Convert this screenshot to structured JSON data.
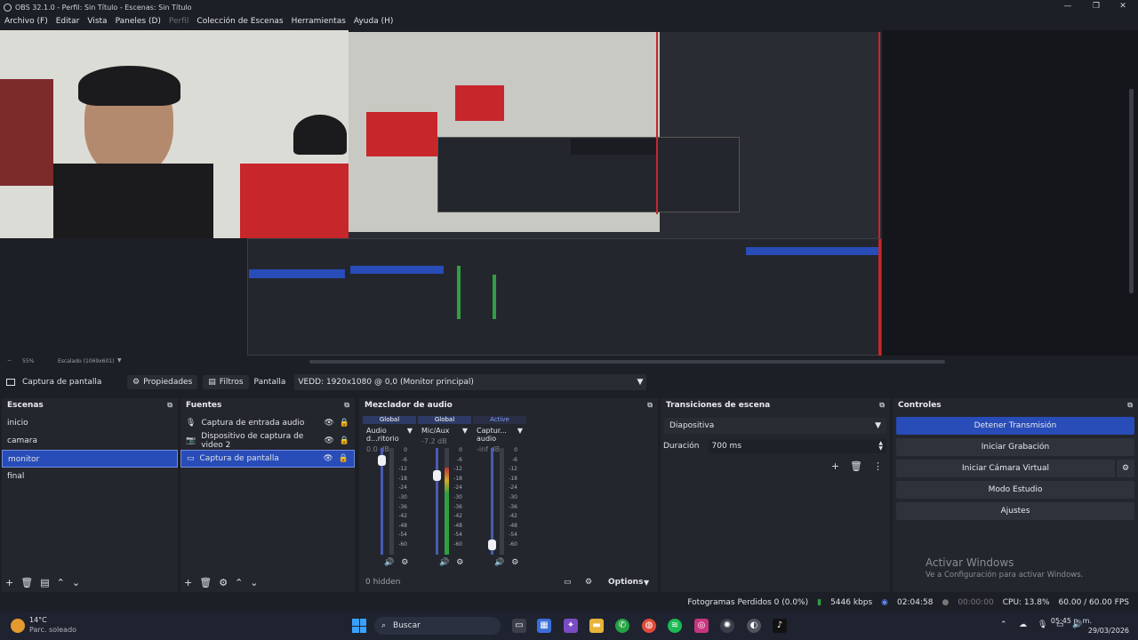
{
  "window": {
    "title": "OBS 32.1.0 - Perfil: Sin Título - Escenas: Sin Título",
    "min": "—",
    "max": "❐",
    "close": "✕"
  },
  "menu": [
    {
      "label": "Archivo (F)"
    },
    {
      "label": "Editar"
    },
    {
      "label": "Vista"
    },
    {
      "label": "Paneles (D)"
    },
    {
      "label": "Perfil",
      "disabled": true
    },
    {
      "label": "Colección de Escenas"
    },
    {
      "label": "Herramientas"
    },
    {
      "label": "Ayuda (H)"
    }
  ],
  "preview": {
    "zoom": "55%",
    "scale": "Escalado (1069x601)"
  },
  "sourcebar": {
    "source": "Captura de pantalla",
    "properties": "Propiedades",
    "filters": "Filtros",
    "display_label": "Pantalla",
    "display_value": "VEDD: 1920x1080 @ 0,0 (Monitor principal)"
  },
  "scenes": {
    "title": "Escenas",
    "items": [
      {
        "label": "inicio"
      },
      {
        "label": "camara"
      },
      {
        "label": "monitor",
        "selected": true
      },
      {
        "label": "final"
      }
    ]
  },
  "sources": {
    "title": "Fuentes",
    "items": [
      {
        "label": "Captura de entrada audio",
        "icon": "microphone-icon"
      },
      {
        "label": "Dispositivo de captura de video 2",
        "icon": "camera-icon"
      },
      {
        "label": "Captura de pantalla",
        "icon": "monitor-icon",
        "selected": true
      }
    ]
  },
  "mixer": {
    "title": "Mezclador de audio",
    "hidden": "0 hidden",
    "options": "Options",
    "channels": [
      {
        "tab": "Global",
        "name": "Audio d...ritorio",
        "db": "0.0 dB",
        "fader": 0.93,
        "level": 0
      },
      {
        "tab": "Global",
        "name": "Mic/Aux",
        "db": "-7.2 dB",
        "fader": 0.77,
        "level": 0.82
      },
      {
        "tab": "Active",
        "name": "Captur... audio",
        "db": "-inf dB",
        "fader": 0.05,
        "level": 0
      }
    ],
    "scale": [
      "0",
      "-6",
      "-12",
      "-18",
      "-24",
      "-30",
      "-36",
      "-42",
      "-48",
      "-54",
      "-60"
    ]
  },
  "transitions": {
    "title": "Transiciones de escena",
    "selected": "Diapositiva",
    "duration_label": "Duración",
    "duration_value": "700 ms"
  },
  "controls": {
    "title": "Controles",
    "buttons": [
      {
        "label": "Detener Transmisión",
        "active": true
      },
      {
        "label": "Iniciar Grabación"
      },
      {
        "label": "Iniciar Cámara Virtual"
      },
      {
        "label": "Modo Estudio"
      },
      {
        "label": "Ajustes"
      }
    ]
  },
  "activation": {
    "title": "Activar Windows",
    "subtitle": "Ve a Configuración para activar Windows."
  },
  "status": {
    "dropped": "Fotogramas Perdidos 0 (0.0%)",
    "bitrate": "5446 kbps",
    "stream_time": "02:04:58",
    "rec_time": "00:00:00",
    "cpu": "CPU: 13.8%",
    "fps": "60.00 / 60.00 FPS"
  },
  "taskbar": {
    "temp": "14°C",
    "weather": "Parc. soleado",
    "search": "Buscar",
    "time": "05:45 p. m.",
    "date": "29/03/2026"
  },
  "colors": {
    "accent": "#284cb8",
    "bg": "#1d1f26",
    "dock": "#24262d"
  }
}
